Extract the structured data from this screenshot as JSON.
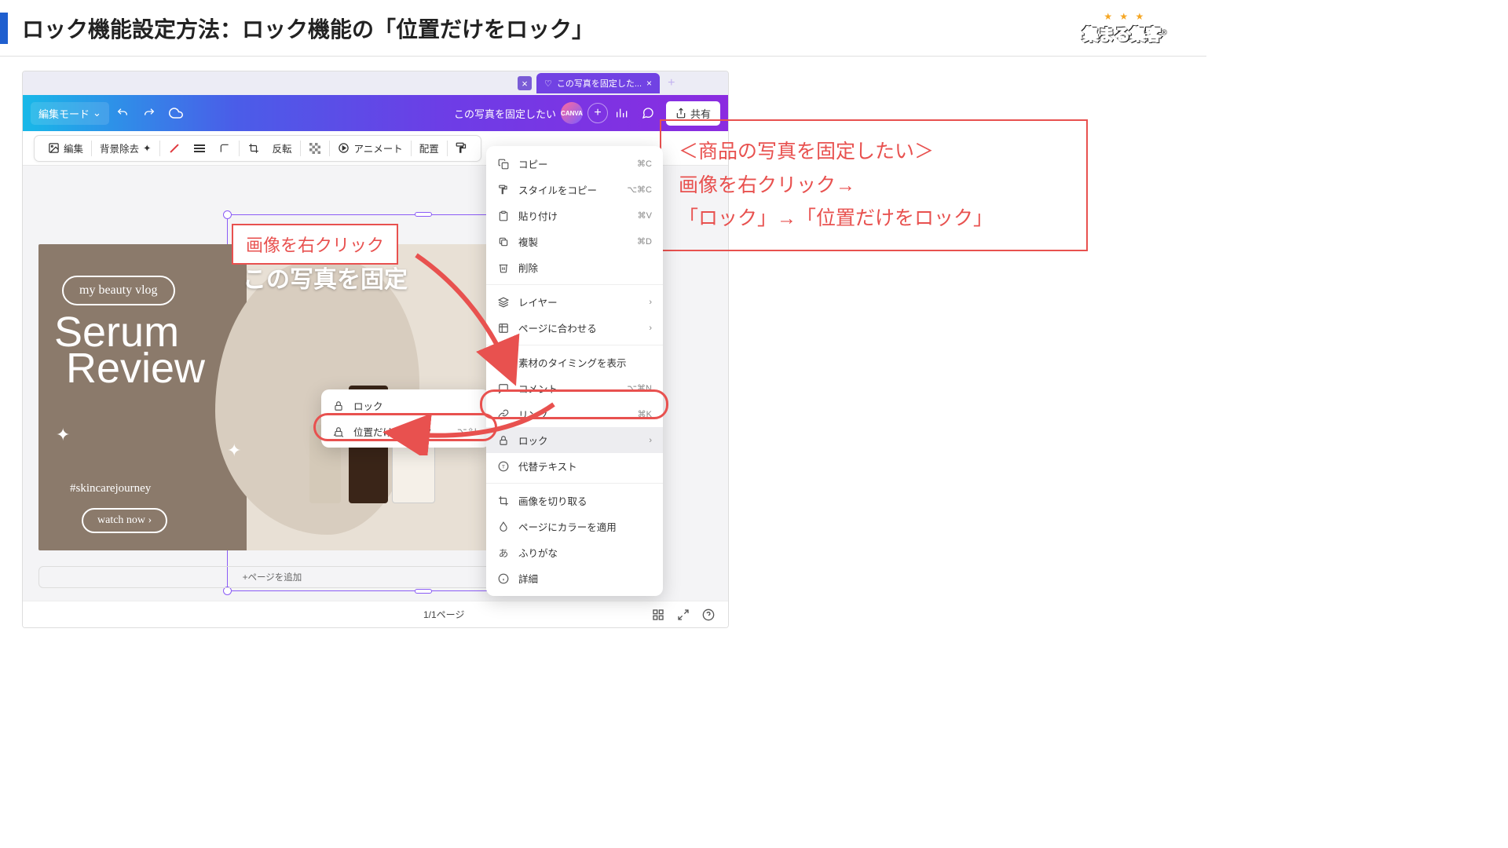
{
  "header": {
    "title": "ロック機能設定方法：ロック機能の「位置だけをロック」",
    "logo_stars": "★ ★ ★",
    "logo_text": "集まる集客",
    "logo_r": "®"
  },
  "browser": {
    "tab_label": "この写真を固定した...",
    "tab_close": "×",
    "tab_plus": "+",
    "prev_tab_close": "×"
  },
  "appbar": {
    "mode": "編集モード",
    "doc_title": "この写真を固定したい",
    "share": "共有"
  },
  "toolbar": {
    "edit": "編集",
    "bg_remove": "背景除去",
    "flip": "反転",
    "animate": "アニメート",
    "position": "配置"
  },
  "design": {
    "vlog": "my beauty vlog",
    "script1": "Serum",
    "script2": "Review",
    "hash": "#skincarejourney",
    "watch": "watch now ›",
    "overlay_jp": "この写真を固定"
  },
  "context_menu": {
    "copy": "コピー",
    "copy_sc": "⌘C",
    "copy_style": "スタイルをコピー",
    "copy_style_sc": "⌥⌘C",
    "paste": "貼り付け",
    "paste_sc": "⌘V",
    "duplicate": "複製",
    "duplicate_sc": "⌘D",
    "delete": "削除",
    "layer": "レイヤー",
    "fit_page": "ページに合わせる",
    "timing": "素材のタイミングを表示",
    "comment": "コメント",
    "comment_sc": "⌥⌘N",
    "link": "リンク",
    "link_sc": "⌘K",
    "lock": "ロック",
    "alt_text": "代替テキスト",
    "crop": "画像を切り取る",
    "page_color": "ページにカラーを適用",
    "furigana": "ふりがな",
    "detail": "詳細"
  },
  "submenu": {
    "lock": "ロック",
    "lock_pos": "位置だけをロック",
    "lock_pos_sc": "⌥⇧L"
  },
  "annotations": {
    "right_click": "画像を右クリック",
    "side_l1": "＜商品の写真を固定したい＞",
    "side_l2": "画像を右クリック→",
    "side_l3": "「ロック」→「位置だけをロック」"
  },
  "canvas": {
    "add_page": "+ページを追加"
  },
  "footer": {
    "page": "1/1ページ"
  }
}
